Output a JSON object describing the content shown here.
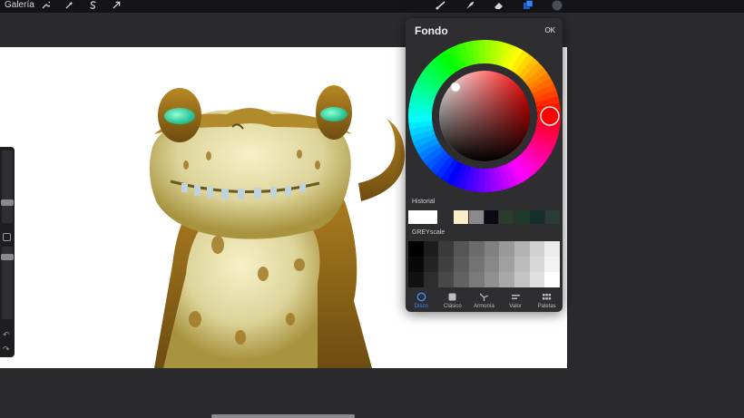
{
  "topbar": {
    "gallery_label": "Galería",
    "left_tools": [
      "wrench-icon",
      "magic-wand-icon",
      "selection-s-icon",
      "arrow-cursor-icon"
    ],
    "right_tools": [
      "brush-icon",
      "smudge-icon",
      "eraser-icon",
      "layers-icon",
      "color-dot-icon"
    ]
  },
  "panel": {
    "title": "Fondo",
    "ok_label": "OK",
    "current_color": "#ff0000",
    "history_label": "Historial",
    "history_colors": [
      "#ffffff",
      "#2e2e30",
      "#f6efc8",
      "#8a8a8c",
      "#0a0a14",
      "#2d3b2d",
      "#1e3a2c",
      "#15302a",
      "#2a3d35"
    ],
    "greyscale_label": "GREYscale",
    "greyscale_colors": [
      "#000000",
      "#1c1c1c",
      "#3a3a3a",
      "#555555",
      "#6b6b6b",
      "#808080",
      "#999999",
      "#b3b3b3",
      "#d0d0d0",
      "#ececec",
      "#080808",
      "#242424",
      "#404040",
      "#5b5b5b",
      "#737373",
      "#888888",
      "#a0a0a0",
      "#bcbcbc",
      "#d8d8d8",
      "#f4f4f4",
      "#111111",
      "#2d2d2d",
      "#484848",
      "#626262",
      "#7a7a7a",
      "#909090",
      "#a8a8a8",
      "#c4c4c4",
      "#e0e0e0",
      "#ffffff"
    ],
    "tabs": [
      {
        "label": "Disco",
        "icon": "disc-icon",
        "active": true
      },
      {
        "label": "Clásico",
        "icon": "square-icon",
        "active": false
      },
      {
        "label": "Armonía",
        "icon": "harmony-icon",
        "active": false
      },
      {
        "label": "Valor",
        "icon": "value-sliders-icon",
        "active": false
      },
      {
        "label": "Paletas",
        "icon": "palettes-grid-icon",
        "active": false
      }
    ]
  }
}
